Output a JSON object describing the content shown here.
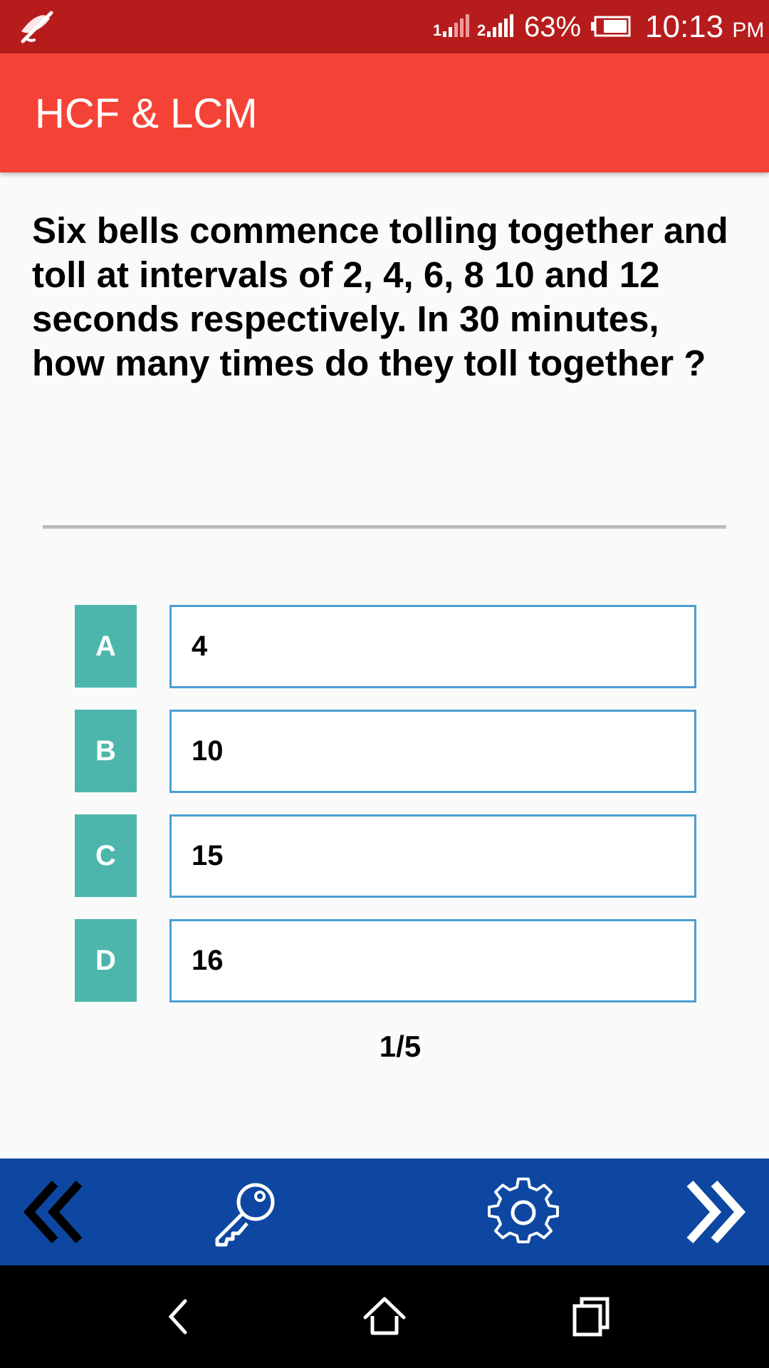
{
  "status_bar": {
    "battery_percent": "63%",
    "time": "10:13",
    "ampm": "PM",
    "sim1_label": "1",
    "sim2_label": "2",
    "icons": [
      "notification-off-icon",
      "sim1-signal-icon",
      "sim2-signal-icon",
      "battery-icon"
    ]
  },
  "app_bar": {
    "title": "HCF & LCM"
  },
  "question": {
    "text": "Six bells commence tolling together and toll at intervals of 2, 4, 6, 8 10 and 12 seconds respectively. In 30 minutes, how many times do they toll together ?"
  },
  "options": [
    {
      "letter": "A",
      "value": "4"
    },
    {
      "letter": "B",
      "value": "10"
    },
    {
      "letter": "C",
      "value": "15"
    },
    {
      "letter": "D",
      "value": "16"
    }
  ],
  "counter": "1/5",
  "bottom_bar": {
    "icons": [
      "double-chevron-left-icon",
      "key-icon",
      "gear-icon",
      "double-chevron-right-icon"
    ]
  },
  "nav_bar": {
    "icons": [
      "back-icon",
      "home-icon",
      "recents-icon"
    ]
  },
  "colors": {
    "status_bar": "#b71c1c",
    "app_bar": "#f44336",
    "option_letter": "#4db6ac",
    "option_border": "#4a9fd0",
    "bottom_bar": "#0d47a1",
    "nav_bar": "#000000"
  }
}
